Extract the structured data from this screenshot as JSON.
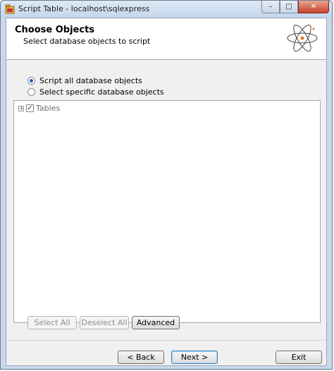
{
  "window": {
    "title": "Script Table - localhost\\sqlexpress",
    "minimize": "–",
    "maximize": "□",
    "close": "✕"
  },
  "header": {
    "title": "Choose Objects",
    "subtitle": "Select database objects to script"
  },
  "options": {
    "script_all": "Script all database objects",
    "select_specific": "Select specific database objects",
    "selected": "script_all"
  },
  "tree": {
    "items": [
      {
        "label": "Tables",
        "expander": "+",
        "checked": "✓"
      }
    ]
  },
  "actions": {
    "select_all": "Select All",
    "deselect_all": "Deselect All",
    "advanced": "Advanced"
  },
  "nav": {
    "back": "< Back",
    "next": "Next >",
    "exit": "Exit"
  }
}
